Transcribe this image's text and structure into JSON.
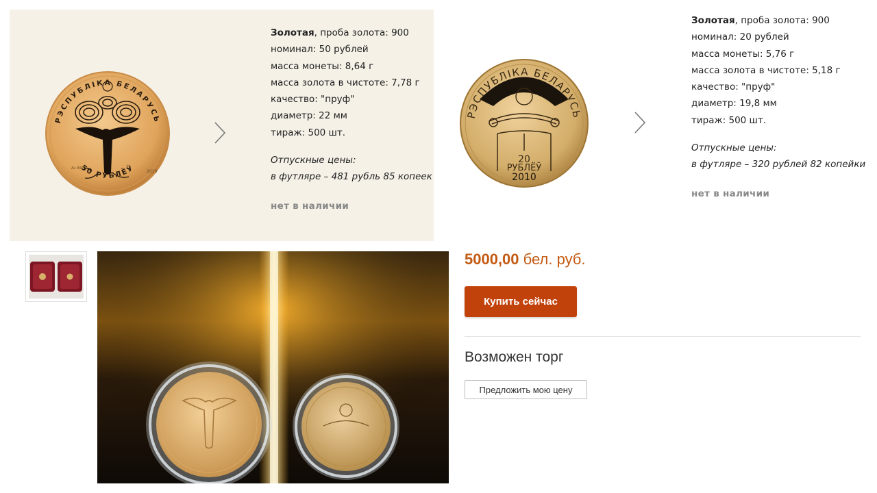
{
  "coin1": {
    "legend": "РЭСПУБЛІКА БЕЛАРУСЬ",
    "denomination": "50 РУБЛЁЎ",
    "mint_mark": "Au 900",
    "year": "2016",
    "spec": {
      "metal": "Золотая",
      "fineness": ", проба золота: 900",
      "nominal": "номинал: 50 рублей",
      "mass": "масса монеты: 8,64 г",
      "pure_mass": "масса золота в чистоте: 7,78 г",
      "quality": "качество: \"пруф\"",
      "diameter": "диаметр: 22 мм",
      "mintage": "тираж: 500 шт.",
      "prices_title": "Отпускные цены:",
      "price_case": "в футляре – 481 рубль 85 копеек",
      "availability": "нет в наличии"
    }
  },
  "coin2": {
    "legend": "РЭСПУБЛІКА БЕЛАРУСЬ",
    "value": "20",
    "denomination": "РУБЛЁЎ",
    "year": "2010",
    "spec": {
      "metal": "Золотая",
      "fineness": ", проба золота: 900",
      "nominal": "номинал: 20 рублей",
      "mass": "масса монеты: 5,76 г",
      "pure_mass": "масса золота в чистоте: 5,18 г",
      "quality": "качество: \"пруф\"",
      "diameter": "диаметр: 19,8 мм",
      "mintage": "тираж: 500 шт.",
      "prices_title": "Отпускные цены:",
      "price_case": "в футляре – 320 рублей 82 копейки",
      "availability": "нет в наличии"
    }
  },
  "listing": {
    "price_value": "5000,00",
    "price_currency": "бел. руб.",
    "buy_label": "Купить сейчас",
    "bargain_label": "Возможен торг",
    "offer_label": "Предложить мою цену"
  },
  "colors": {
    "accent": "#c2420c",
    "price": "#c45a12",
    "panel_bg": "#f5f1e7",
    "gold": "#d9a860"
  },
  "icons": {
    "next_arrow": "chevron-right-icon"
  }
}
